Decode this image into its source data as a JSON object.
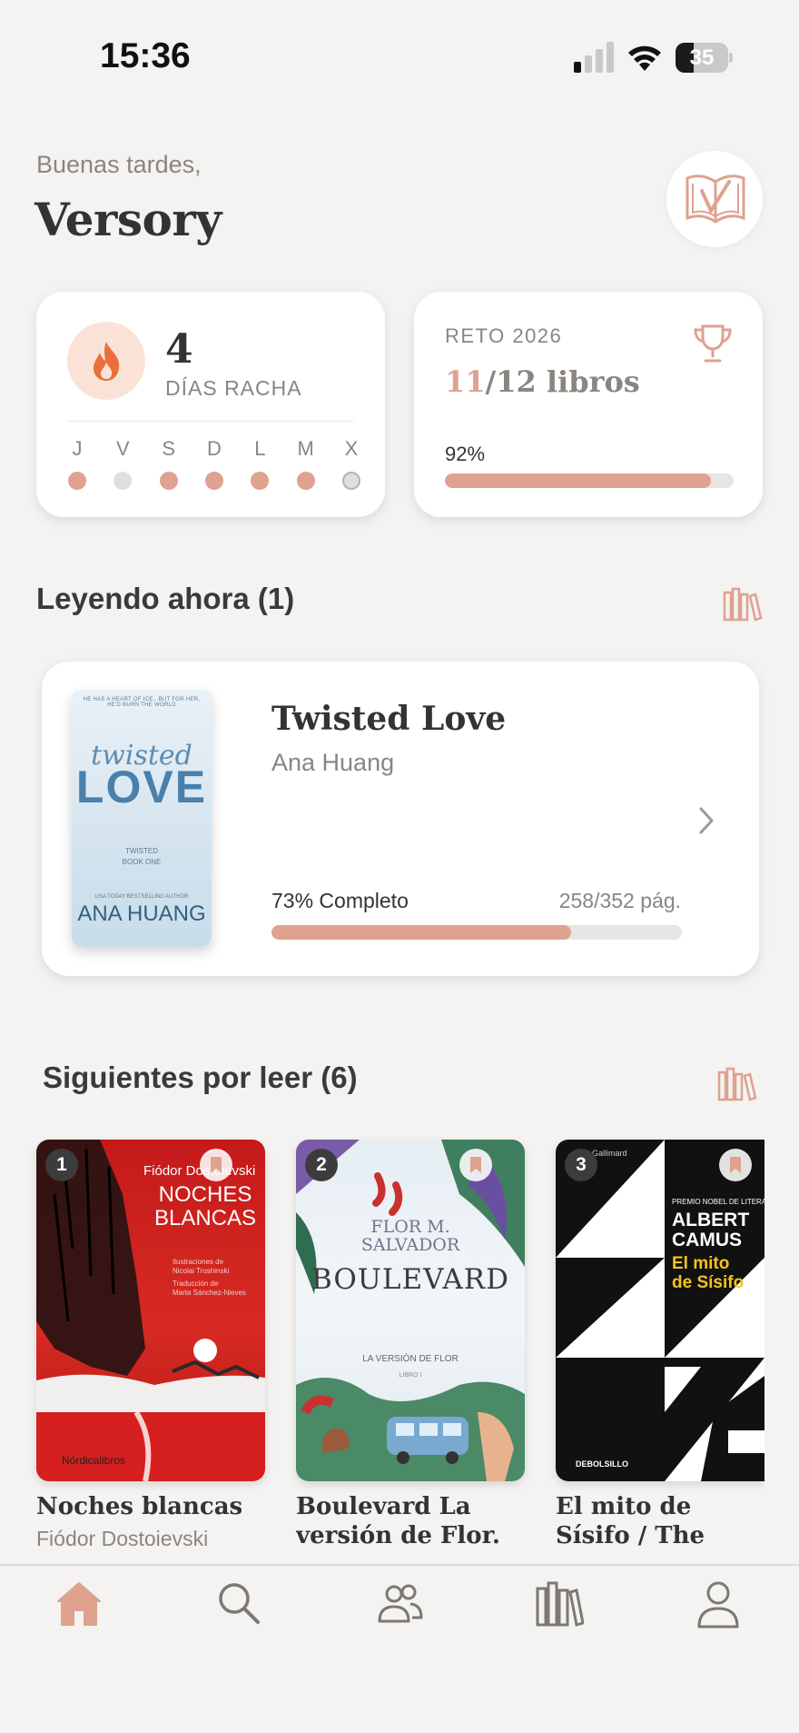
{
  "status_bar": {
    "time": "15:36",
    "battery": "35"
  },
  "header": {
    "greeting": "Buenas tardes,",
    "app_name": "Versory",
    "logo_icon": "open-book-check-icon"
  },
  "streak": {
    "count": "4",
    "label": "DÍAS RACHA",
    "days": [
      {
        "letter": "J",
        "state": "done"
      },
      {
        "letter": "V",
        "state": "missed"
      },
      {
        "letter": "S",
        "state": "done"
      },
      {
        "letter": "D",
        "state": "done"
      },
      {
        "letter": "L",
        "state": "done"
      },
      {
        "letter": "M",
        "state": "done"
      },
      {
        "letter": "X",
        "state": "today"
      }
    ]
  },
  "challenge": {
    "title": "RETO 2026",
    "current": "11",
    "total_text": "/12 libros",
    "percent_label": "92%",
    "percent": 92
  },
  "reading_now": {
    "section_title": "Leyendo ahora (1)",
    "book": {
      "title": "Twisted Love",
      "author": "Ana Huang",
      "progress_label": "73% Completo",
      "pages": "258/352 pág.",
      "progress": 73,
      "cover": {
        "tagline": "HE HAS A HEART OF ICE...BUT FOR HER, HE'D BURN THE WORLD",
        "script": "twisted",
        "title": "LOVE",
        "series": "TWISTED",
        "series_book": "BOOK ONE",
        "bestseller": "USA TODAY BESTSELLING AUTHOR",
        "author": "ANA HUANG"
      }
    }
  },
  "next_up": {
    "section_title": "Siguientes por leer (6)",
    "books": [
      {
        "rank": "1",
        "title": "Noches blancas",
        "author": "Fiódor Dostoievski",
        "cover": {
          "author": "Fiódor Dostoievski",
          "title1": "NOCHES",
          "title2": "BLANCAS",
          "note1": "Ilustraciones de",
          "note2": "Nicolai Troshinski",
          "note3": "Traducción de",
          "note4": "Marta Sánchez-Nieves",
          "publisher": "Nórdicalibros"
        }
      },
      {
        "rank": "2",
        "title": "Boulevard La versión de Flor. L...",
        "author": "Flor M. Salvador",
        "cover": {
          "author1": "FLOR M.",
          "author2": "SALVADOR",
          "title": "BOULEVARD",
          "subtitle": "LA VERSIÓN DE FLOR",
          "book": "LIBRO I"
        }
      },
      {
        "rank": "3",
        "title": "El mito de Sísifo / The Myth of Sisy...",
        "author": "Albert Camus",
        "cover": {
          "top": "Gallimard",
          "prize": "PREMIO NOBEL DE LITERATURA",
          "author1": "ALBERT",
          "author2": "CAMUS",
          "title1": "El mito",
          "title2": "de Sísifo",
          "publisher": "DEBOLSILLO"
        }
      }
    ]
  },
  "tab_bar": {
    "tabs": [
      {
        "name": "home",
        "icon": "home-icon",
        "active": true
      },
      {
        "name": "search",
        "icon": "search-icon",
        "active": false
      },
      {
        "name": "community",
        "icon": "people-icon",
        "active": false
      },
      {
        "name": "library",
        "icon": "bookshelf-icon",
        "active": false
      },
      {
        "name": "profile",
        "icon": "user-icon",
        "active": false
      }
    ]
  },
  "colors": {
    "accent": "#dea28f",
    "background": "#f4f3f1",
    "muted_text": "#8b8580"
  }
}
